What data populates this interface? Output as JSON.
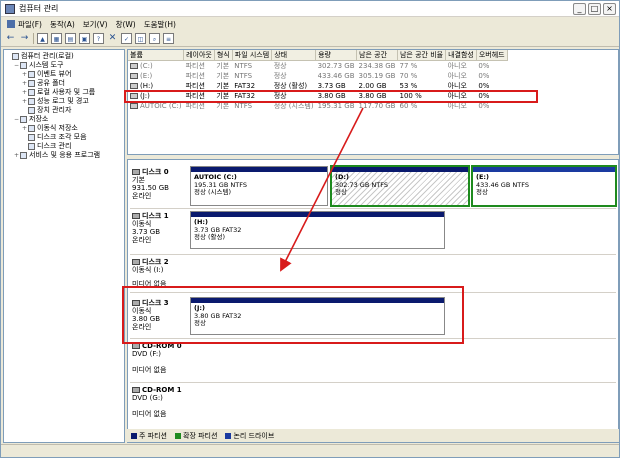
{
  "window": {
    "title": "컴퓨터 관리"
  },
  "menu": [
    "파일(F)",
    "동작(A)",
    "보기(V)",
    "창(W)",
    "도움말(H)"
  ],
  "tree": [
    {
      "label": "컴퓨터 관리(로컬)",
      "indent": 0,
      "exp": ""
    },
    {
      "label": "시스템 도구",
      "indent": 1,
      "exp": "−"
    },
    {
      "label": "이벤트 뷰어",
      "indent": 2,
      "exp": "+"
    },
    {
      "label": "공유 폴더",
      "indent": 2,
      "exp": "+"
    },
    {
      "label": "로컬 사용자 및 그룹",
      "indent": 2,
      "exp": "+"
    },
    {
      "label": "성능 로그 및 경고",
      "indent": 2,
      "exp": "+"
    },
    {
      "label": "장치 관리자",
      "indent": 2,
      "exp": ""
    },
    {
      "label": "저장소",
      "indent": 1,
      "exp": "−"
    },
    {
      "label": "이동식 저장소",
      "indent": 2,
      "exp": "+"
    },
    {
      "label": "디스크 조각 모음",
      "indent": 2,
      "exp": ""
    },
    {
      "label": "디스크 관리",
      "indent": 2,
      "exp": ""
    },
    {
      "label": "서비스 및 응용 프로그램",
      "indent": 1,
      "exp": "+"
    }
  ],
  "volumes": {
    "headers": [
      "볼륨",
      "레이아웃",
      "형식",
      "파일 시스템",
      "상태",
      "용량",
      "남은 공간",
      "남은 공간 비율",
      "내결함성",
      "오버헤드"
    ],
    "rows": [
      [
        "(C:)",
        "파티션",
        "기본",
        "NTFS",
        "정상",
        "302.73 GB",
        "234.38 GB",
        "77 %",
        "아니오",
        "0%"
      ],
      [
        "(E:)",
        "파티션",
        "기본",
        "NTFS",
        "정상",
        "433.46 GB",
        "305.19 GB",
        "70 %",
        "아니오",
        "0%"
      ],
      [
        "(H:)",
        "파티션",
        "기본",
        "FAT32",
        "정상 (활성)",
        "3.73 GB",
        "2.00 GB",
        "53 %",
        "아니오",
        "0%"
      ],
      [
        "(J:)",
        "파티션",
        "기본",
        "FAT32",
        "정상",
        "3.80 GB",
        "3.80 GB",
        "100 %",
        "아니오",
        "0%"
      ],
      [
        "AUTOIC (C:)",
        "파티션",
        "기본",
        "NTFS",
        "정상 (시스템)",
        "195.31 GB",
        "117.70 GB",
        "60 %",
        "아니오",
        "0%"
      ]
    ]
  },
  "disks": [
    {
      "name": "디스크 0",
      "type": "기본",
      "size": "931.50 GB",
      "status": "온라인"
    },
    {
      "name": "디스크 1",
      "type": "이동식",
      "size": "3.73 GB",
      "status": "온라인"
    },
    {
      "name": "디스크 2",
      "type": "이동식 (I:)",
      "size": "",
      "status": "미디어 없음"
    },
    {
      "name": "디스크 3",
      "type": "이동식",
      "size": "3.80 GB",
      "status": "온라인"
    },
    {
      "name": "CD-ROM 0",
      "type": "DVD (F:)",
      "size": "",
      "status": "미디어 없음"
    },
    {
      "name": "CD-ROM 1",
      "type": "DVD (G:)",
      "size": "",
      "status": "미디어 없음"
    }
  ],
  "partitions": {
    "d0p1": {
      "name": "AUTOIC (C:)",
      "line1": "195.31 GB NTFS",
      "line2": "정상 (시스템)"
    },
    "d0p2": {
      "name": "(D:)",
      "line1": "302.73 GB NTFS",
      "line2": "정상"
    },
    "d0p3": {
      "name": "(E:)",
      "line1": "433.46 GB NTFS",
      "line2": "정상"
    },
    "d1p1": {
      "name": "(H:)",
      "line1": "3.73 GB FAT32",
      "line2": "정상 (활성)"
    },
    "d3p1": {
      "name": "(J:)",
      "line1": "3.80 GB FAT32",
      "line2": "정상"
    }
  },
  "legend": [
    "주 파티션",
    "확장 파티션",
    "논리 드라이브"
  ],
  "colors": {
    "primary": "#0a1a6e",
    "extended": "#1e8a1e",
    "logical": "#1a3aa0",
    "highlight": "#d81b1b"
  }
}
